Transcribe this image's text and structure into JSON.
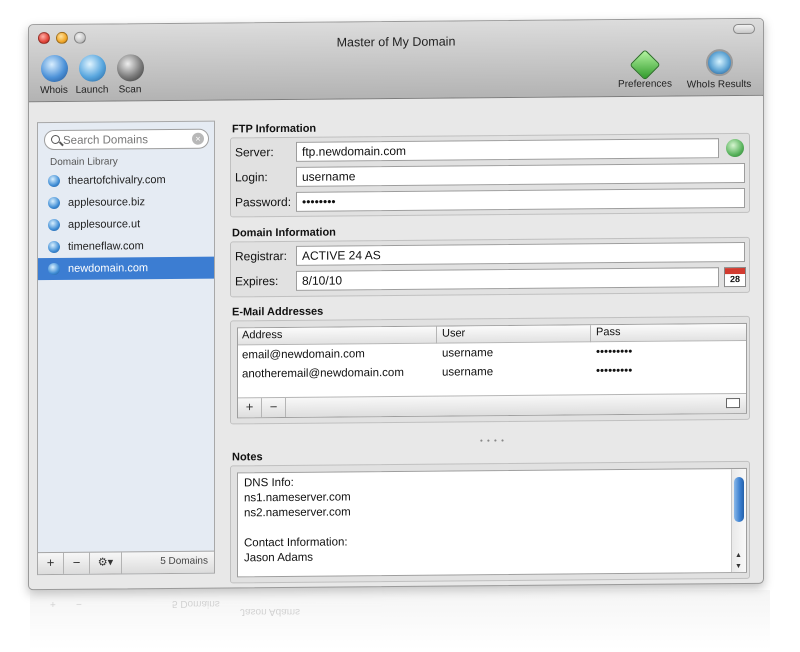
{
  "window": {
    "title": "Master of My Domain"
  },
  "toolbar": {
    "items": [
      {
        "label": "Whois",
        "icon": "globe-whois-icon"
      },
      {
        "label": "Launch",
        "icon": "globe-launch-icon"
      },
      {
        "label": "Scan",
        "icon": "scan-icon"
      }
    ],
    "right_items": [
      {
        "label": "Preferences",
        "icon": "preferences-icon"
      },
      {
        "label": "WhoIs Results",
        "icon": "whois-results-icon"
      }
    ]
  },
  "sidebar": {
    "search_placeholder": "Search Domains",
    "library_header": "Domain Library",
    "domains": [
      {
        "name": "theartofchivalry.com",
        "selected": false
      },
      {
        "name": "applesource.biz",
        "selected": false
      },
      {
        "name": "applesource.ut",
        "selected": false
      },
      {
        "name": "timeneflaw.com",
        "selected": false
      },
      {
        "name": "newdomain.com",
        "selected": true
      }
    ],
    "footer": {
      "add": "+",
      "remove": "−",
      "action": "⚙▾",
      "count": "5 Domains"
    }
  },
  "ftp": {
    "title": "FTP Information",
    "server_label": "Server:",
    "server_value": "ftp.newdomain.com",
    "login_label": "Login:",
    "login_value": "username",
    "password_label": "Password:",
    "password_value": "••••••••"
  },
  "domain": {
    "title": "Domain Information",
    "registrar_label": "Registrar:",
    "registrar_value": "ACTIVE 24 AS",
    "expires_label": "Expires:",
    "expires_value": "8/10/10",
    "calendar_day": "28"
  },
  "email": {
    "title": "E-Mail Addresses",
    "columns": [
      "Address",
      "User",
      "Pass"
    ],
    "rows": [
      {
        "address": "email@newdomain.com",
        "user": "username",
        "pass": "•••••••••"
      },
      {
        "address": "anotheremail@newdomain.com",
        "user": "username",
        "pass": "•••••••••"
      }
    ],
    "add": "+",
    "remove": "−"
  },
  "notes": {
    "title": "Notes",
    "lines": [
      "DNS Info:",
      "ns1.nameserver.com",
      "ns2.nameserver.com",
      "",
      "Contact Information:",
      "Jason Adams"
    ]
  },
  "colors": {
    "selection": "#3c7dd2",
    "window_bg": "#e8e8e8"
  }
}
